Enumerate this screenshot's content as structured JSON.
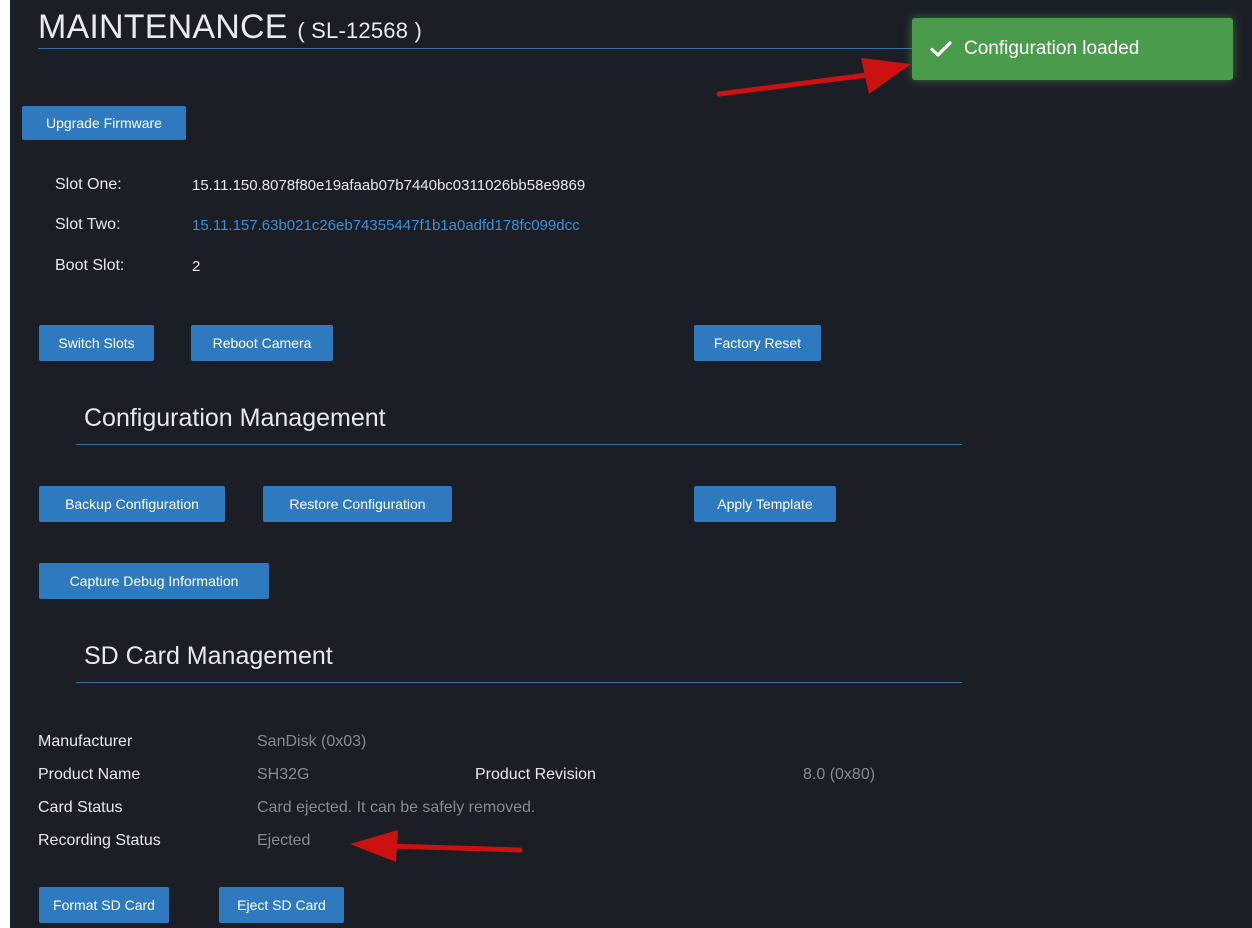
{
  "header": {
    "title": "MAINTENANCE",
    "serial": "( SL-12568 )"
  },
  "toast": {
    "message": "Configuration loaded",
    "icon": "check-icon",
    "color": "#4a9b4c"
  },
  "firmware": {
    "upgrade_label": "Upgrade Firmware",
    "slots": [
      {
        "label": "Slot One:",
        "value": "15.11.150.8078f80e19afaab07b7440bc0311026bb58e9869"
      },
      {
        "label": "Slot Two:",
        "value": "15.11.157.63b021c26eb74355447f1b1a0adfd178fc099dcc"
      },
      {
        "label": "Boot Slot:",
        "value": "2"
      }
    ],
    "switch_label": "Switch Slots",
    "reboot_label": "Reboot Camera",
    "factory_label": "Factory Reset"
  },
  "config": {
    "title": "Configuration Management",
    "backup_label": "Backup Configuration",
    "restore_label": "Restore Configuration",
    "template_label": "Apply Template",
    "debug_label": "Capture Debug Information"
  },
  "sd": {
    "title": "SD Card Management",
    "manufacturer_label": "Manufacturer",
    "manufacturer_value": "SanDisk (0x03)",
    "product_name_label": "Product Name",
    "product_name_value": "SH32G",
    "product_revision_label": "Product Revision",
    "product_revision_value": "8.0 (0x80)",
    "card_status_label": "Card Status",
    "card_status_value": "Card ejected. It can be safely removed.",
    "recording_status_label": "Recording Status",
    "recording_status_value": "Ejected",
    "format_label": "Format SD Card",
    "eject_label": "Eject SD Card"
  },
  "colors": {
    "background": "#1c1e26",
    "button": "#2f7abf",
    "link": "#3a8fd6",
    "annotation_arrow": "#cc1111"
  }
}
